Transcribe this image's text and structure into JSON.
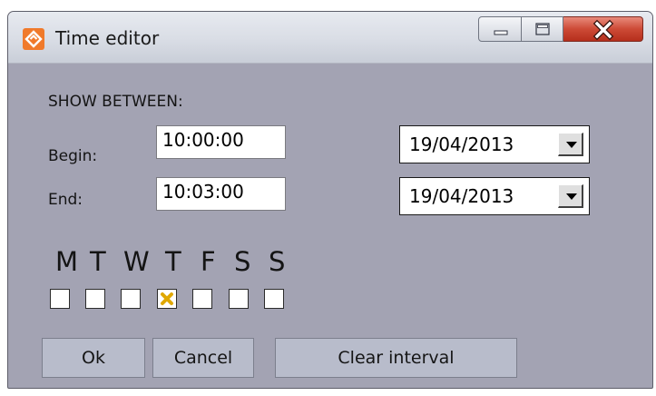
{
  "window": {
    "title": "Time editor",
    "controls": {
      "minimize_icon": "minimize-icon",
      "maximize_icon": "maximize-icon",
      "close_icon": "close-icon"
    }
  },
  "form": {
    "section_label": "SHOW BETWEEN:",
    "begin_label": "Begin:",
    "begin_time": "10:00:00",
    "begin_date": "19/04/2013",
    "end_label": "End:",
    "end_time": "10:03:00",
    "end_date": "19/04/2013"
  },
  "weekdays": {
    "letters": [
      "M",
      "T",
      "W",
      "T",
      "F",
      "S",
      "S"
    ],
    "checked": [
      false,
      false,
      false,
      true,
      false,
      false,
      false
    ],
    "check_color": "#e0a800"
  },
  "buttons": {
    "ok": "Ok",
    "cancel": "Cancel",
    "clear": "Clear interval"
  },
  "colors": {
    "accent": "#f07a2b",
    "close_button": "#c8402c",
    "dialog_background": "#a3a3b3"
  }
}
